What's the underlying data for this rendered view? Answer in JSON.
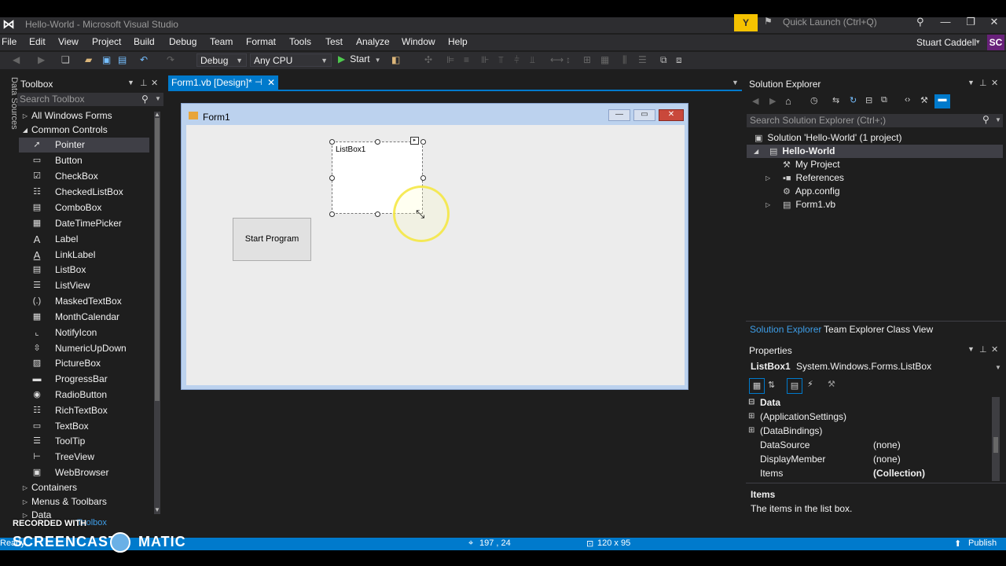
{
  "window": {
    "title": "Hello-World - Microsoft Visual Studio",
    "quick_launch_placeholder": "Quick Launch (Ctrl+Q)",
    "user_name": "Stuart Caddell",
    "user_initials": "SC"
  },
  "menu": [
    "File",
    "Edit",
    "View",
    "Project",
    "Build",
    "Debug",
    "Team",
    "Format",
    "Tools",
    "Test",
    "Analyze",
    "Window",
    "Help"
  ],
  "toolbar": {
    "config": "Debug",
    "platform": "Any CPU",
    "start_label": "Start"
  },
  "side_tab": "Data Sources",
  "toolbox": {
    "title": "Toolbox",
    "search_placeholder": "Search Toolbox",
    "items": [
      {
        "label": "All Windows Forms",
        "icon": "triangle-right",
        "group": true
      },
      {
        "label": "Common Controls",
        "icon": "triangle-down",
        "group": true
      },
      {
        "label": "Pointer",
        "icon": "pointer"
      },
      {
        "label": "Button",
        "icon": "button"
      },
      {
        "label": "CheckBox",
        "icon": "checkbox"
      },
      {
        "label": "CheckedListBox",
        "icon": "checkedlistbox"
      },
      {
        "label": "ComboBox",
        "icon": "combobox"
      },
      {
        "label": "DateTimePicker",
        "icon": "datetimepicker"
      },
      {
        "label": "Label",
        "icon": "label"
      },
      {
        "label": "LinkLabel",
        "icon": "linklabel"
      },
      {
        "label": "ListBox",
        "icon": "listbox"
      },
      {
        "label": "ListView",
        "icon": "listview"
      },
      {
        "label": "MaskedTextBox",
        "icon": "maskedtextbox"
      },
      {
        "label": "MonthCalendar",
        "icon": "monthcalendar"
      },
      {
        "label": "NotifyIcon",
        "icon": "notifyicon"
      },
      {
        "label": "NumericUpDown",
        "icon": "numericupdown"
      },
      {
        "label": "PictureBox",
        "icon": "picturebox"
      },
      {
        "label": "ProgressBar",
        "icon": "progressbar"
      },
      {
        "label": "RadioButton",
        "icon": "radiobutton"
      },
      {
        "label": "RichTextBox",
        "icon": "richtextbox"
      },
      {
        "label": "TextBox",
        "icon": "textbox"
      },
      {
        "label": "ToolTip",
        "icon": "tooltip"
      },
      {
        "label": "TreeView",
        "icon": "treeview"
      },
      {
        "label": "WebBrowser",
        "icon": "webbrowser"
      },
      {
        "label": "Containers",
        "icon": "triangle-right",
        "group": true
      },
      {
        "label": "Menus & Toolbars",
        "icon": "triangle-right",
        "group": true
      },
      {
        "label": "Data",
        "icon": "triangle-right",
        "group": true
      }
    ],
    "bottom_tab": "Toolbox"
  },
  "document": {
    "tab_label": "Form1.vb [Design]*",
    "form_title": "Form1",
    "start_button_label": "Start Program",
    "listbox_label": "ListBox1"
  },
  "solution_explorer": {
    "title": "Solution Explorer",
    "search_placeholder": "Search Solution Explorer (Ctrl+;)",
    "tree": [
      {
        "label": "Solution 'Hello-World' (1 project)",
        "icon": "solution"
      },
      {
        "label": "Hello-World",
        "icon": "vb-project",
        "bold": true
      },
      {
        "label": "My Project",
        "icon": "wrench"
      },
      {
        "label": "References",
        "icon": "references"
      },
      {
        "label": "App.config",
        "icon": "config"
      },
      {
        "label": "Form1.vb",
        "icon": "form"
      }
    ],
    "tabs": [
      "Solution Explorer",
      "Team Explorer",
      "Class View"
    ]
  },
  "properties": {
    "title": "Properties",
    "object": "ListBox1",
    "object_type": "System.Windows.Forms.ListBox",
    "category": "Data",
    "rows": [
      {
        "name": "(ApplicationSettings)",
        "value": ""
      },
      {
        "name": "(DataBindings)",
        "value": ""
      },
      {
        "name": "DataSource",
        "value": "(none)"
      },
      {
        "name": "DisplayMember",
        "value": "(none)"
      },
      {
        "name": "Items",
        "value": "(Collection)"
      }
    ],
    "desc_title": "Items",
    "desc_text": "The items in the list box."
  },
  "status": {
    "position": "197 , 24",
    "size": "120 x 95",
    "publish": "Publish",
    "ready": "Ready"
  },
  "watermark": {
    "recorded_with": "RECORDED WITH",
    "brand_left": "SCREENCAST",
    "brand_right": "MATIC"
  },
  "colors": {
    "accent": "#007acc",
    "chrome": "#2d2d30",
    "background": "#1e1e1e",
    "feedback": "#f5c200"
  }
}
